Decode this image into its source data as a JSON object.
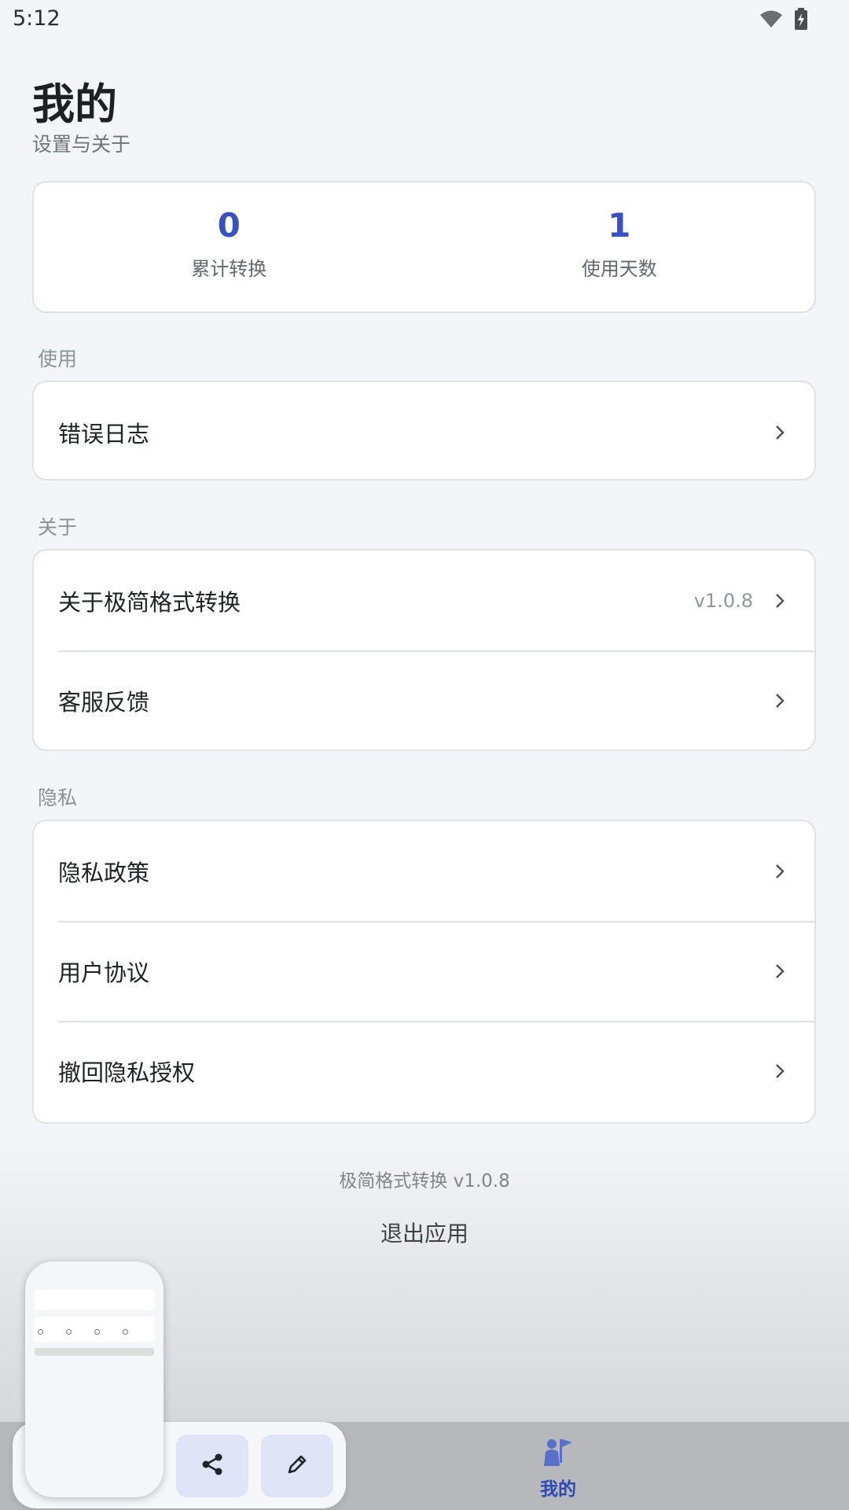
{
  "status": {
    "time": "5:12"
  },
  "header": {
    "title": "我的",
    "subtitle": "设置与关于"
  },
  "stats": [
    {
      "value": "0",
      "label": "累计转换"
    },
    {
      "value": "1",
      "label": "使用天数"
    }
  ],
  "sections": {
    "usage": {
      "label": "使用",
      "items": [
        {
          "label": "错误日志"
        }
      ]
    },
    "about": {
      "label": "关于",
      "items": [
        {
          "label": "关于极简格式转换",
          "value": "v1.0.8"
        },
        {
          "label": "客服反馈"
        }
      ]
    },
    "privacy": {
      "label": "隐私",
      "items": [
        {
          "label": "隐私政策"
        },
        {
          "label": "用户协议"
        },
        {
          "label": "撤回隐私授权"
        }
      ]
    }
  },
  "footer": {
    "version": "极简格式转换 v1.0.8",
    "exit_label": "退出应用"
  },
  "nav": {
    "me_label": "我的"
  },
  "colors": {
    "accent": "#3751c4",
    "nav_active": "#2c49b5",
    "card_border": "#dde2e6"
  },
  "icons": {
    "status": [
      "wifi-icon",
      "battery-charging-icon"
    ],
    "chevron": "chevron-right-icon",
    "share": "share-icon",
    "edit": "pencil-icon",
    "nav_me": "person-flag-icon"
  }
}
